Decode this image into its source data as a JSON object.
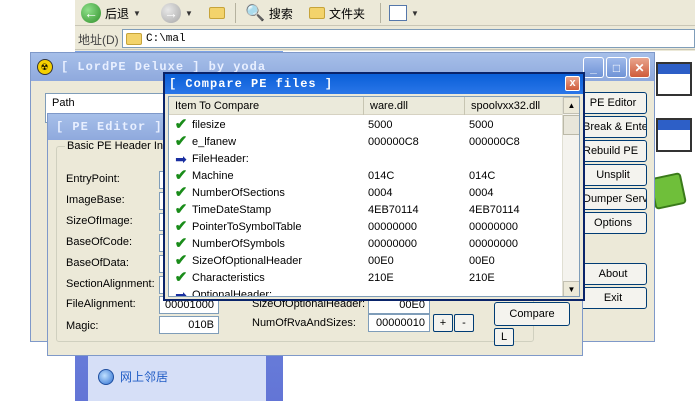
{
  "explorer": {
    "toolbar": {
      "back_label": "后退",
      "search_label": "搜索",
      "folders_label": "文件夹"
    },
    "address": {
      "label": "地址(D)",
      "value": "C:\\mal"
    },
    "task_items": [
      "网上邻居"
    ]
  },
  "lordpe": {
    "title": "[ LordPE Deluxe ] by yoda",
    "list_header": "Path",
    "right_buttons": [
      "PE Editor",
      "Break & Enter",
      "Rebuild PE",
      "Unsplit",
      "Dumper Server",
      "Options",
      "About",
      "Exit"
    ]
  },
  "pe_editor": {
    "title": "[ PE Editor ]",
    "group_label": "Basic PE Header Information",
    "fields": [
      {
        "label": "EntryPoint:",
        "value": ""
      },
      {
        "label": "ImageBase:",
        "value": ""
      },
      {
        "label": "SizeOfImage:",
        "value": ""
      },
      {
        "label": "BaseOfCode:",
        "value": ""
      },
      {
        "label": "BaseOfData:",
        "value": ""
      },
      {
        "label": "SectionAlignment:",
        "value": ""
      },
      {
        "label": "FileAlignment:",
        "value": "00001000"
      },
      {
        "label": "Magic:",
        "value": "010B"
      }
    ],
    "right_fields": [
      {
        "label": "SizeOfOptionalHeader:",
        "value": "00E0"
      },
      {
        "label": "NumOfRvaAndSizes:",
        "value": "00000010"
      }
    ],
    "plus_label": "+",
    "minus_label": "-",
    "compare_label": "Compare",
    "l_label": "L"
  },
  "compare": {
    "title": "[ Compare PE files ]",
    "close_label": "x",
    "columns": [
      "Item To Compare",
      "ware.dll",
      "spoolvxx32.dll"
    ],
    "rows": [
      {
        "icon": "check",
        "item": "filesize",
        "a": "5000",
        "b": "5000"
      },
      {
        "icon": "check",
        "item": "e_lfanew",
        "a": "000000C8",
        "b": "000000C8"
      },
      {
        "icon": "arrow",
        "item": "FileHeader:",
        "a": "",
        "b": ""
      },
      {
        "icon": "check",
        "item": "Machine",
        "a": "014C",
        "b": "014C"
      },
      {
        "icon": "check",
        "item": "NumberOfSections",
        "a": "0004",
        "b": "0004"
      },
      {
        "icon": "check",
        "item": "TimeDateStamp",
        "a": "4EB70114",
        "b": "4EB70114"
      },
      {
        "icon": "check",
        "item": "PointerToSymbolTable",
        "a": "00000000",
        "b": "00000000"
      },
      {
        "icon": "check",
        "item": "NumberOfSymbols",
        "a": "00000000",
        "b": "00000000"
      },
      {
        "icon": "check",
        "item": "SizeOfOptionalHeader",
        "a": "00E0",
        "b": "00E0"
      },
      {
        "icon": "check",
        "item": "Characteristics",
        "a": "210E",
        "b": "210E"
      },
      {
        "icon": "arrow",
        "item": "OptionalHeader:",
        "a": "",
        "b": ""
      }
    ]
  }
}
